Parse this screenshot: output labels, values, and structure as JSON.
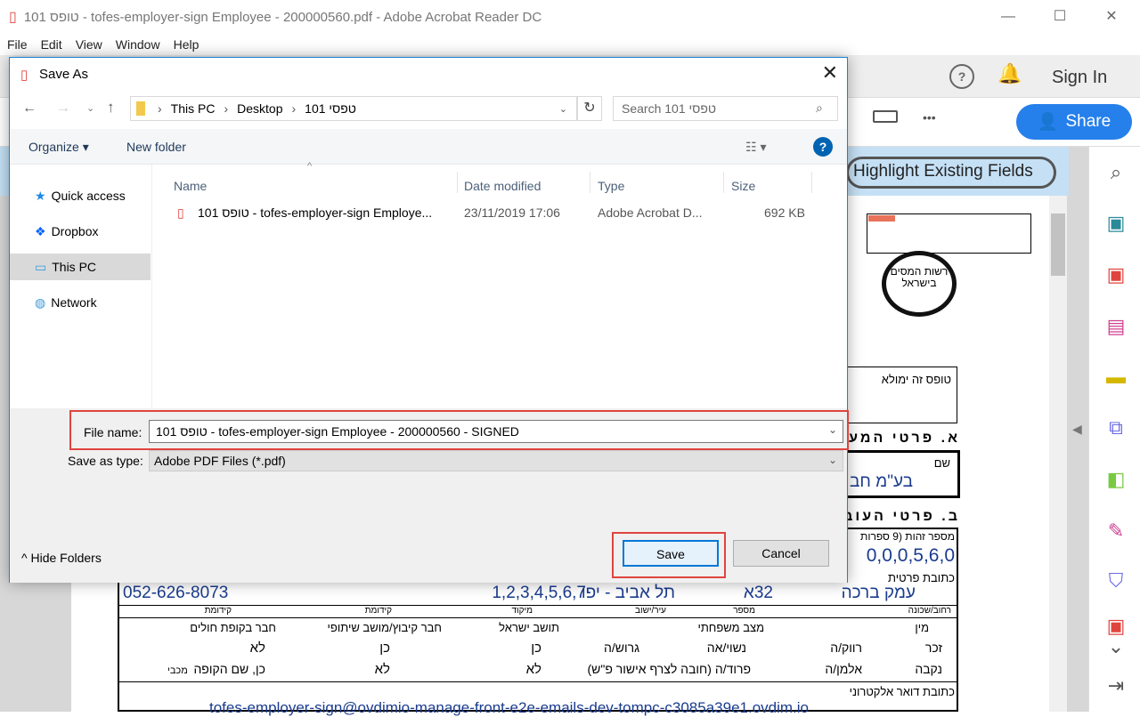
{
  "window": {
    "title": "101 טופס - tofes-employer-sign Employee - 200000560.pdf - Adobe Acrobat Reader DC",
    "minimize": "—",
    "maximize": "☐",
    "close": "✕"
  },
  "menu": [
    "File",
    "Edit",
    "View",
    "Window",
    "Help"
  ],
  "toolbar": {
    "sign_in": "Sign In",
    "share": "Share",
    "more": "•••"
  },
  "form_bar": {
    "highlight": "Highlight Existing Fields"
  },
  "dialog": {
    "title": "Save As",
    "breadcrumb": [
      "This PC",
      "Desktop",
      "טפסי 101"
    ],
    "search_placeholder": "Search 101 טפסי",
    "organize": "Organize ▾",
    "new_folder": "New folder",
    "help": "?",
    "nav": [
      {
        "label": "Quick access",
        "icon": "star-icon"
      },
      {
        "label": "Dropbox",
        "icon": "dropbox-icon"
      },
      {
        "label": "This PC",
        "icon": "computer-icon",
        "selected": true
      },
      {
        "label": "Network",
        "icon": "network-icon"
      }
    ],
    "columns": [
      "Name",
      "Date modified",
      "Type",
      "Size"
    ],
    "files": [
      {
        "name": "101 טופס - tofes-employer-sign Employe...",
        "date": "23/11/2019 17:06",
        "type": "Adobe Acrobat D...",
        "size": "692 KB"
      }
    ],
    "file_name_label": "File name:",
    "file_name": "101 טופס - tofes-employer-sign Employee - 200000560 - SIGNED",
    "save_type_label": "Save as type:",
    "save_type": "Adobe PDF Files (*.pdf)",
    "hide_folders": "Hide Folders",
    "save": "Save",
    "cancel": "Cancel"
  },
  "pdf": {
    "logo": "רשות המסים בישראל",
    "notice": "טופס זה ימולא",
    "section_a": "א. פרטי המעב",
    "name_label": "שם",
    "name_value": "בע\"מ חב",
    "section_b": "ב. פרטי העובד",
    "id_label": "מספר זהות (9 ספרות",
    "id_value": "0,0,0,5,6,0",
    "address_label": "כתובת פרטית",
    "street": "עמק ברכה",
    "house": "32א",
    "city": "תל אביב - יפו",
    "zip": "1,2,3,4,5,6,7",
    "phone": "052-626-8073",
    "sub_labels": [
      "רחוב/שכונה",
      "מספר",
      "עיר/ישוב",
      "מיקוד",
      "קידומת",
      "קידומת"
    ],
    "gender": {
      "title": "מין",
      "options": [
        "זכר",
        "נקבה"
      ]
    },
    "marital": {
      "title": "מצב משפחתי",
      "options": [
        "רווק/ה",
        "נשוי/אה",
        "גרוש/ה",
        "אלמן/ה",
        "פרוד/ה (חובה לצרף אישור פ\"ש)"
      ]
    },
    "resident": {
      "title": "תושב ישראל",
      "options": [
        "כן",
        "לא"
      ]
    },
    "kibbutz": {
      "title": "חבר קיבוץ/מושב שיתופי",
      "options": [
        "כן",
        "לא"
      ]
    },
    "health": {
      "title": "חבר בקופת חולים",
      "options": [
        "לא",
        "כן, שם הקופה"
      ],
      "fund": "מכבי"
    },
    "email_label": "כתובת דואר אלקטרוני",
    "email": "tofes-employer-sign@ovdimio-manage-front-e2e-emails-dev-tompc-c3085a39e1.ovdim.io"
  },
  "colors": {
    "accent": "#2680eb",
    "dialog_border": "#1883d7",
    "highlight_red": "#e0443e",
    "form_bar": "#c5e0f5"
  }
}
